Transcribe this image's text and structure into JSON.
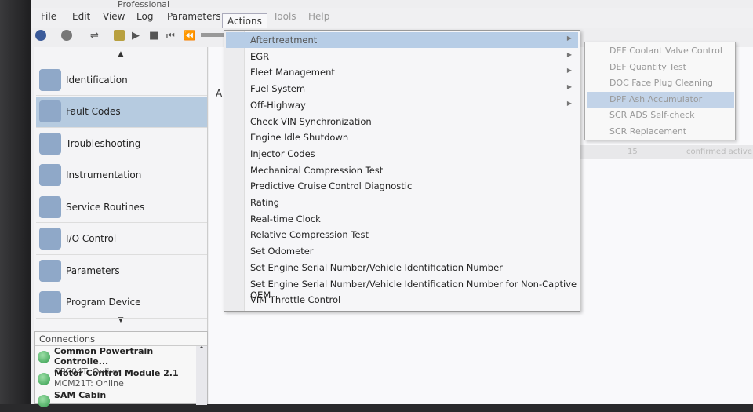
{
  "window": {
    "title": "Professional"
  },
  "menubar": [
    "File",
    "Edit",
    "View",
    "Log",
    "Parameters",
    "Actions",
    "Tools",
    "Help"
  ],
  "sidebar": {
    "items": [
      {
        "label": "Identification",
        "icon": "id-card-icon"
      },
      {
        "label": "Fault Codes",
        "icon": "fault-light-icon",
        "selected": true
      },
      {
        "label": "Troubleshooting",
        "icon": "stethoscope-icon"
      },
      {
        "label": "Instrumentation",
        "icon": "gauge-icon"
      },
      {
        "label": "Service Routines",
        "icon": "gears-icon"
      },
      {
        "label": "I/O Control",
        "icon": "gear-icon"
      },
      {
        "label": "Parameters",
        "icon": "clipboard-icon"
      },
      {
        "label": "Program Device",
        "icon": "chip-icon"
      }
    ]
  },
  "connections": {
    "title": "Connections",
    "items": [
      {
        "name": "Common Powertrain Controlle...",
        "status": "CPC04T: Online"
      },
      {
        "name": "Motor Control Module 2.1",
        "status": "MCM21T: Online"
      },
      {
        "name": "SAM Cabin",
        "status": ""
      }
    ]
  },
  "actions_menu": {
    "items": [
      {
        "label": "Aftertreatment",
        "submenu": true,
        "highlighted": true
      },
      {
        "label": "EGR",
        "submenu": true
      },
      {
        "label": "Fleet Management",
        "submenu": true
      },
      {
        "label": "Fuel System",
        "submenu": true
      },
      {
        "label": "Off-Highway",
        "submenu": true
      },
      {
        "label": "Check VIN Synchronization"
      },
      {
        "label": "Engine Idle Shutdown"
      },
      {
        "label": "Injector Codes"
      },
      {
        "label": "Mechanical Compression Test"
      },
      {
        "label": "Predictive Cruise Control Diagnostic"
      },
      {
        "label": "Rating"
      },
      {
        "label": "Real-time Clock"
      },
      {
        "label": "Relative Compression Test"
      },
      {
        "label": "Set Odometer"
      },
      {
        "label": "Set Engine Serial Number/Vehicle Identification Number"
      },
      {
        "label": "Set Engine Serial Number/Vehicle Identification Number for Non-Captive OEM"
      },
      {
        "label": "VIM Throttle Control"
      }
    ]
  },
  "aftertreatment_submenu": {
    "items": [
      {
        "label": "DEF Coolant Valve Control"
      },
      {
        "label": "DEF Quantity Test"
      },
      {
        "label": "DOC Face Plug Cleaning"
      },
      {
        "label": "DPF Ash Accumulator",
        "highlighted": true
      },
      {
        "label": "SCR ADS Self-check"
      },
      {
        "label": "SCR Replacement"
      }
    ]
  },
  "content": {
    "tab_label": "A",
    "row": {
      "code": "15",
      "status": "confirmed active"
    }
  },
  "colors": {
    "highlight": "#b7cde6",
    "selected_nav": "#b6cbe0",
    "online": "#2f9a4a"
  }
}
